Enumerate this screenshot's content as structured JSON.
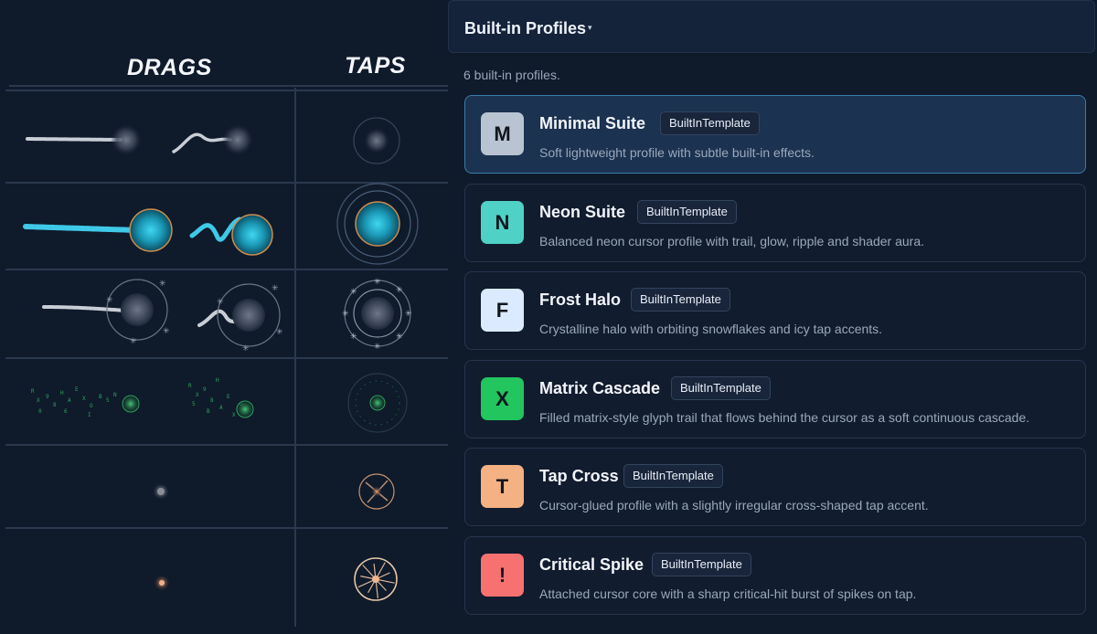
{
  "preview": {
    "drags_title": "DRAGS",
    "taps_title": "TAPS"
  },
  "panel": {
    "title": "Built-in Profiles",
    "caret": "▾",
    "count_text": "6 built-in profiles."
  },
  "profiles": [
    {
      "letter": "M",
      "name": "Minimal Suite",
      "tag": "BuiltInTemplate",
      "description": "Soft lightweight profile with subtle built-in effects.",
      "color": "#b9c4d2",
      "selected": true
    },
    {
      "letter": "N",
      "name": "Neon Suite",
      "tag": "BuiltInTemplate",
      "description": "Balanced neon cursor profile with trail, glow, ripple and shader aura.",
      "color": "#4fd1c5",
      "selected": false
    },
    {
      "letter": "F",
      "name": "Frost Halo",
      "tag": "BuiltInTemplate",
      "description": "Crystalline halo with orbiting snowflakes and icy tap accents.",
      "color": "#dbeafe",
      "selected": false
    },
    {
      "letter": "X",
      "name": "Matrix Cascade",
      "tag": "BuiltInTemplate",
      "description": "Filled matrix-style glyph trail that flows behind the cursor as a soft continuous cascade.",
      "color": "#22c55e",
      "selected": false
    },
    {
      "letter": "T",
      "name": "Tap Cross",
      "tag": "BuiltInTemplate",
      "description": "Cursor-glued profile with a slightly irregular cross-shaped tap accent.",
      "color": "#f4b183",
      "selected": false
    },
    {
      "letter": "!",
      "name": "Critical Spike",
      "tag": "BuiltInTemplate",
      "description": "Attached cursor core with a sharp critical-hit burst of spikes on tap.",
      "color": "#f87171",
      "selected": false
    }
  ],
  "matrix_glyphs": [
    "R",
    "X",
    "9",
    "8",
    "H",
    "A",
    "E",
    "X",
    "O",
    "B",
    "5",
    "N",
    "0",
    "6",
    "I"
  ]
}
